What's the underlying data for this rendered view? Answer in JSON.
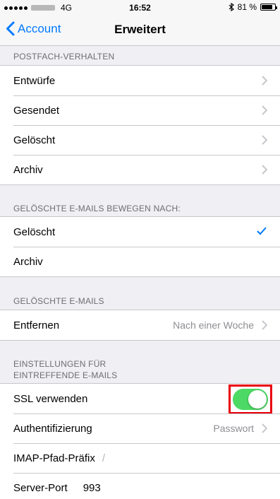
{
  "status_bar": {
    "network": "4G",
    "time": "16:52",
    "battery_text": "81 %",
    "battery_level": 0.81
  },
  "nav": {
    "back_label": "Account",
    "title": "Erweitert"
  },
  "sections": {
    "postfach": {
      "header": "POSTFACH-VERHALTEN",
      "rows": [
        "Entwürfe",
        "Gesendet",
        "Gelöscht",
        "Archiv"
      ]
    },
    "move_deleted": {
      "header": "GELÖSCHTE E-MAILS BEWEGEN NACH:",
      "rows": [
        "Gelöscht",
        "Archiv"
      ],
      "selected": "Gelöscht"
    },
    "deleted_mails": {
      "header": "GELÖSCHTE E-MAILS",
      "remove_label": "Entfernen",
      "remove_value": "Nach einer Woche"
    },
    "incoming": {
      "header_line1": "EINSTELLUNGEN FÜR",
      "header_line2": "EINTREFFENDE E-MAILS",
      "ssl_label": "SSL verwenden",
      "ssl_enabled": true,
      "auth_label": "Authentifizierung",
      "auth_value": "Passwort",
      "imap_label": "IMAP-Pfad-Präfix",
      "imap_value": "/",
      "port_label": "Server-Port",
      "port_value": "993"
    }
  },
  "colors": {
    "accent": "#007aff",
    "toggle_on": "#4cd964",
    "highlight": "#e8000b",
    "header_text": "#6d6d72"
  }
}
